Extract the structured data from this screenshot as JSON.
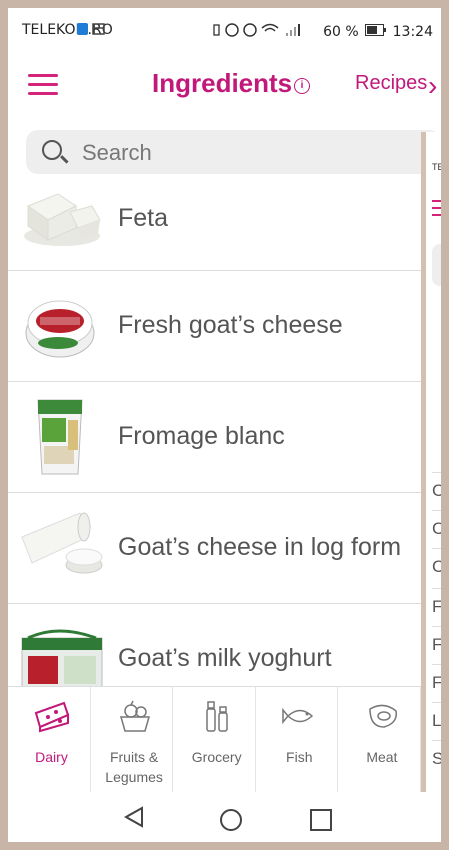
{
  "status_bar": {
    "carrier": "TELEKOM.RO",
    "battery": "60 %",
    "time": "13:24"
  },
  "header": {
    "title": "Ingredients",
    "info_symbol": "i",
    "recipes_label": "Recipes",
    "chevron": "›",
    "accent_color": "#c2187a"
  },
  "search": {
    "placeholder": "Search"
  },
  "ingredients": [
    {
      "label": "Feta",
      "icon": "feta-cheese-image"
    },
    {
      "label": "Fresh goat’s cheese",
      "icon": "goat-cheese-tub-image"
    },
    {
      "label": "Fromage blanc",
      "icon": "fromage-blanc-pot-image"
    },
    {
      "label": "Goat’s cheese in log form",
      "icon": "goat-cheese-log-image"
    },
    {
      "label": "Goat’s milk yoghurt",
      "icon": "goat-yoghurt-pack-image"
    }
  ],
  "peek_panel": {
    "status_snippet": "TE",
    "items": [
      "C",
      "C",
      "C",
      "F",
      "F",
      "F",
      "L",
      "S"
    ]
  },
  "bottom_nav": [
    {
      "label": "Dairy",
      "icon": "cheese-icon",
      "active": true
    },
    {
      "label": "Fruits & Legumes",
      "icon": "fruit-basket-icon",
      "active": false
    },
    {
      "label": "Grocery",
      "icon": "salt-pepper-icon",
      "active": false
    },
    {
      "label": "Fish",
      "icon": "fish-icon",
      "active": false
    },
    {
      "label": "Meat",
      "icon": "steak-icon",
      "active": false
    }
  ]
}
